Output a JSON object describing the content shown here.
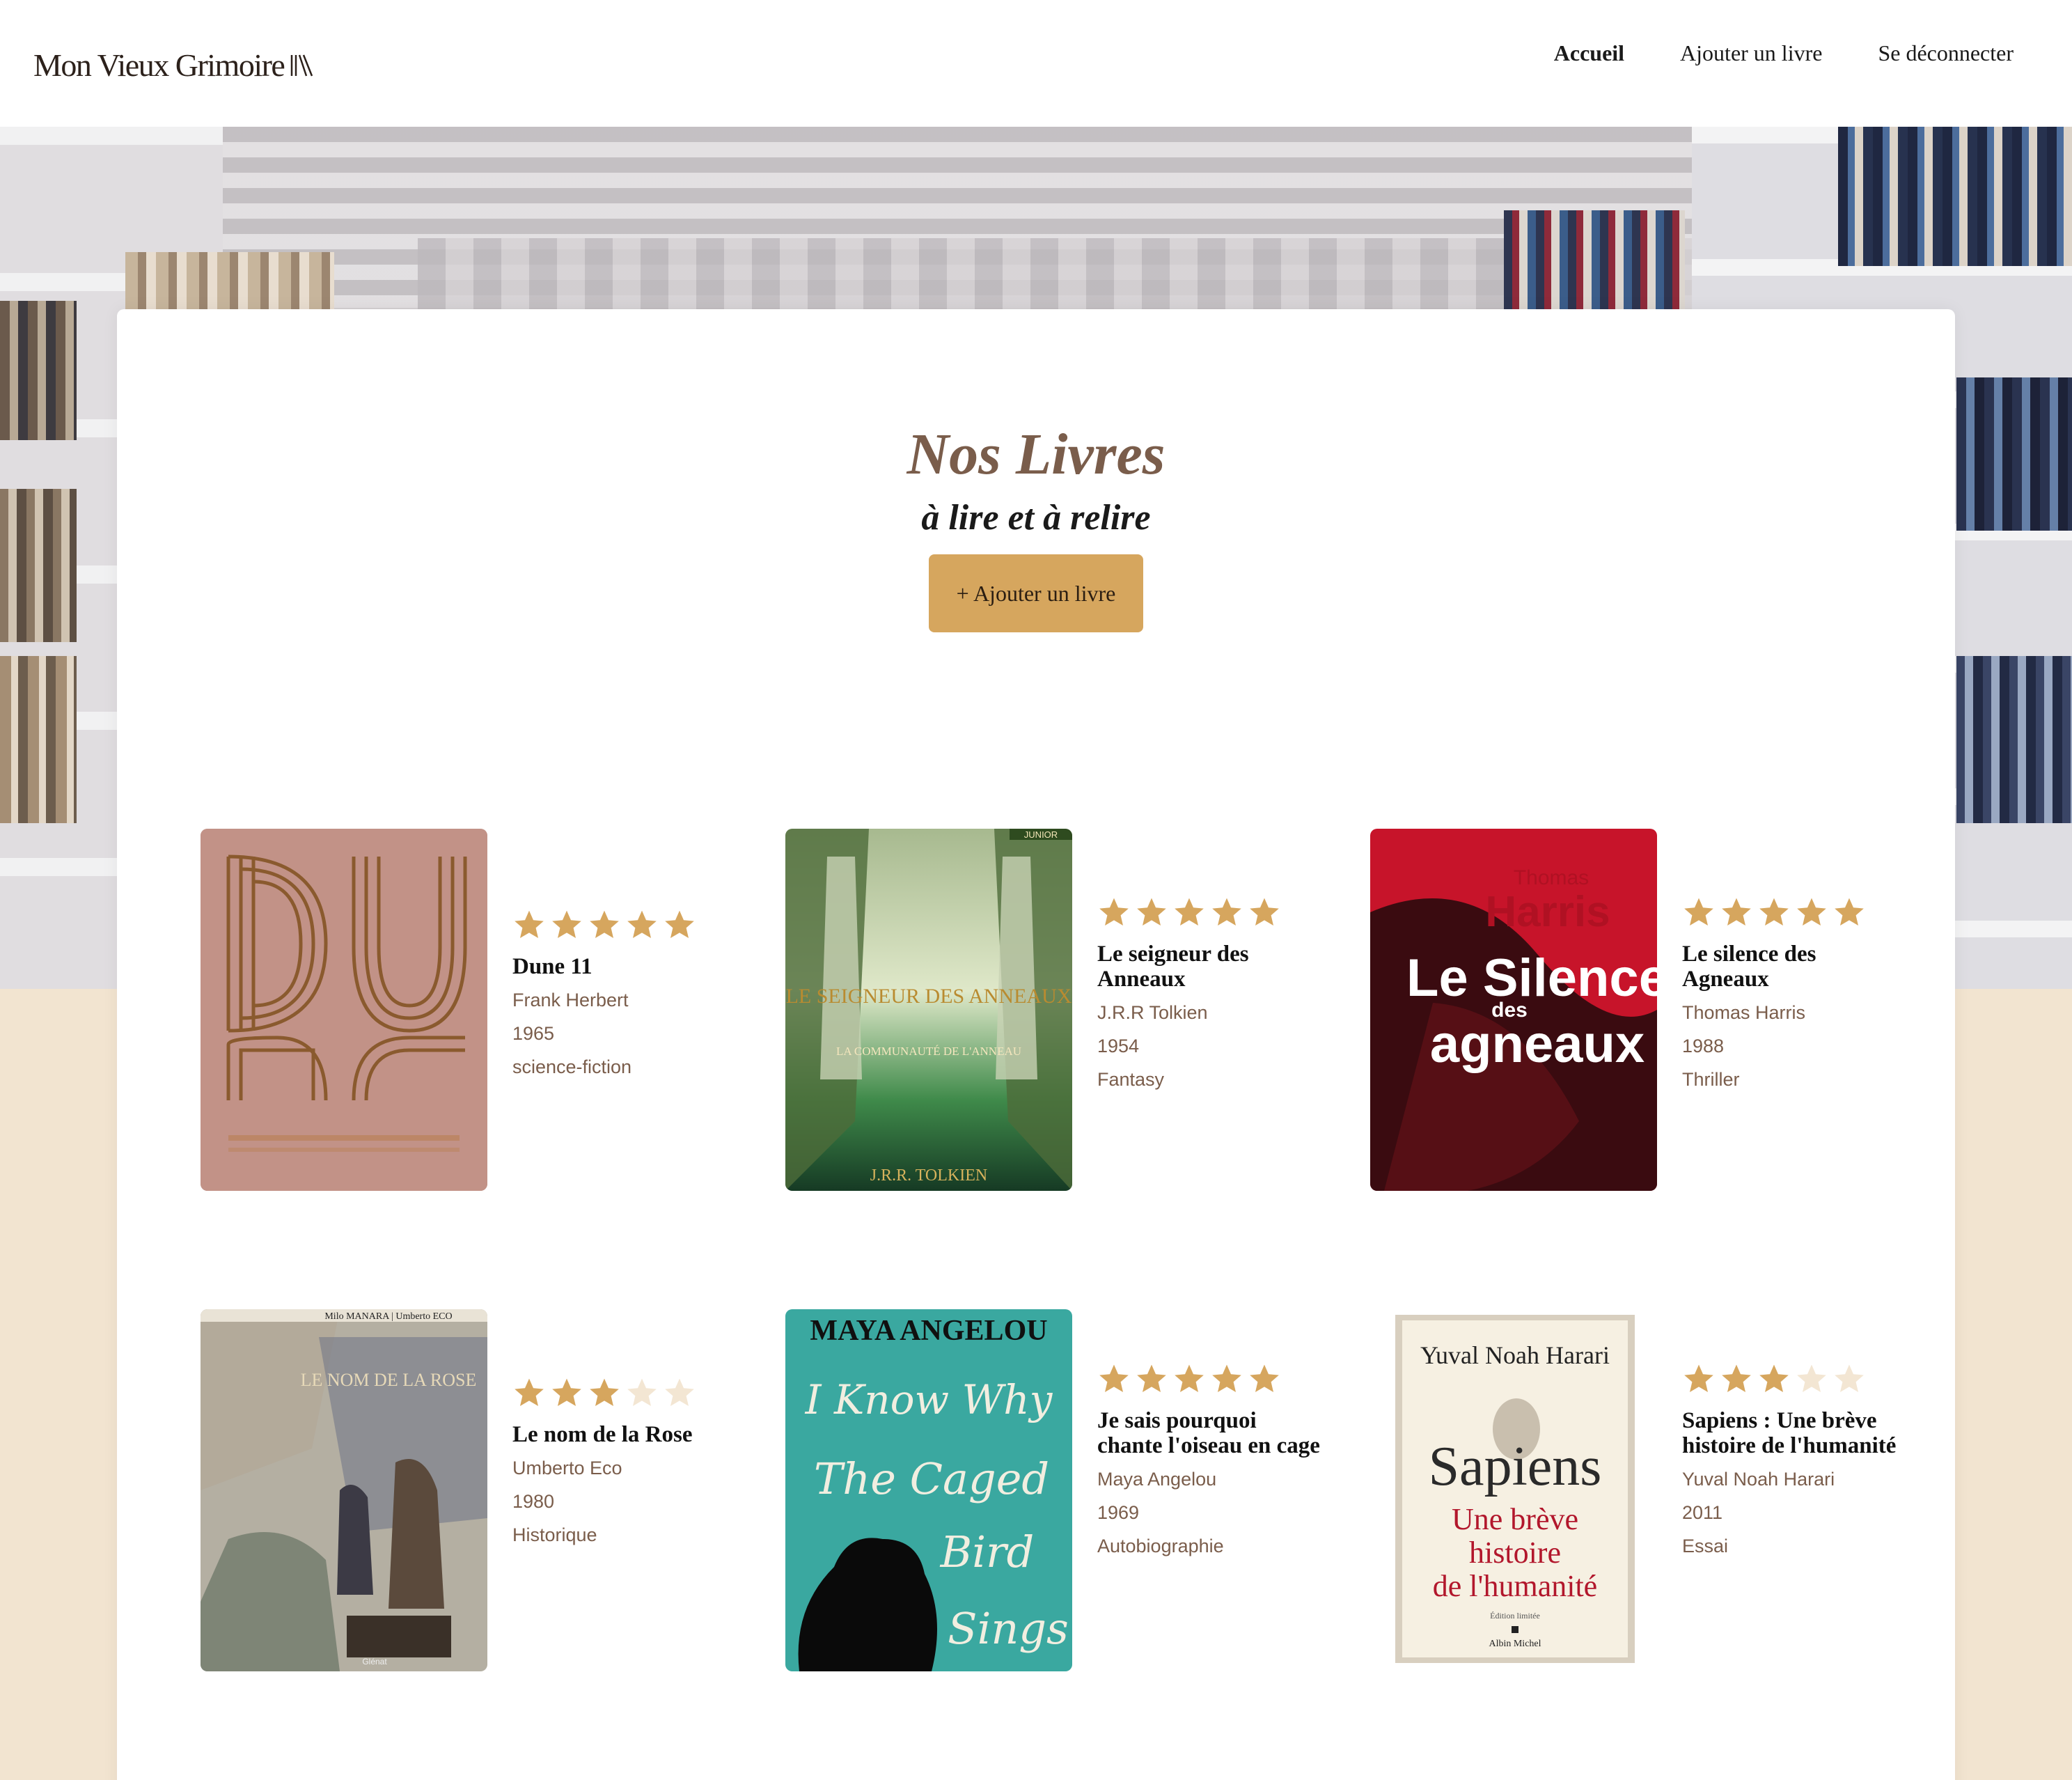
{
  "header": {
    "logo_text": "Mon Vieux Grimoire",
    "nav": [
      {
        "label": "Accueil",
        "active": true
      },
      {
        "label": "Ajouter un livre",
        "active": false
      },
      {
        "label": "Se déconnecter",
        "active": false
      }
    ]
  },
  "main": {
    "title": "Nos Livres",
    "subtitle": "à lire et à relire",
    "add_button": "+ Ajouter un livre"
  },
  "colors": {
    "accent": "#d6a65e",
    "brown": "#7a5d4b",
    "star_filled": "#d6a65e",
    "star_empty": "#f3e6d3",
    "background": "#f2e4d0"
  },
  "books": [
    {
      "title": "Dune 11",
      "author": "Frank Herbert",
      "year": "1965",
      "genre": "science-fiction",
      "rating": 5
    },
    {
      "title": "Le seigneur des Anneaux",
      "author": "J.R.R Tolkien",
      "year": "1954",
      "genre": "Fantasy",
      "rating": 5
    },
    {
      "title": "Le silence des Agneaux",
      "author": "Thomas Harris",
      "year": "1988",
      "genre": "Thriller",
      "rating": 5
    },
    {
      "title": "Le nom de la Rose",
      "author": "Umberto Eco",
      "year": "1980",
      "genre": "Historique",
      "rating": 3
    },
    {
      "title": "Je sais pourquoi chante l'oiseau en cage",
      "author": "Maya Angelou",
      "year": "1969",
      "genre": "Autobiographie",
      "rating": 5
    },
    {
      "title": "Sapiens : Une brève histoire de l'humanité",
      "author": "Yuval Noah Harari",
      "year": "2011",
      "genre": "Essai",
      "rating": 3
    }
  ],
  "covers": [
    {
      "lines": [
        "DUNE"
      ]
    },
    {
      "lines": [
        "JUNIOR",
        "LE SEIGNEUR DES ANNEAUX",
        "LA COMMUNAUTÉ DE L'ANNEAU",
        "J.R.R. TOLKIEN"
      ]
    },
    {
      "lines": [
        "Thomas",
        "Harris",
        "Le Silence",
        "des",
        "agneaux"
      ]
    },
    {
      "lines": [
        "Milo MANARA | Umberto ECO",
        "LE NOM DE LA ROSE",
        "Glénat"
      ]
    },
    {
      "lines": [
        "MAYA ANGELOU",
        "I Know Why",
        "The Caged",
        "Bird",
        "Sings"
      ]
    },
    {
      "lines": [
        "Yuval Noah Harari",
        "Sapiens",
        "Une brève",
        "histoire",
        "de l'humanité",
        "Édition limitée",
        "Albin Michel"
      ]
    }
  ]
}
